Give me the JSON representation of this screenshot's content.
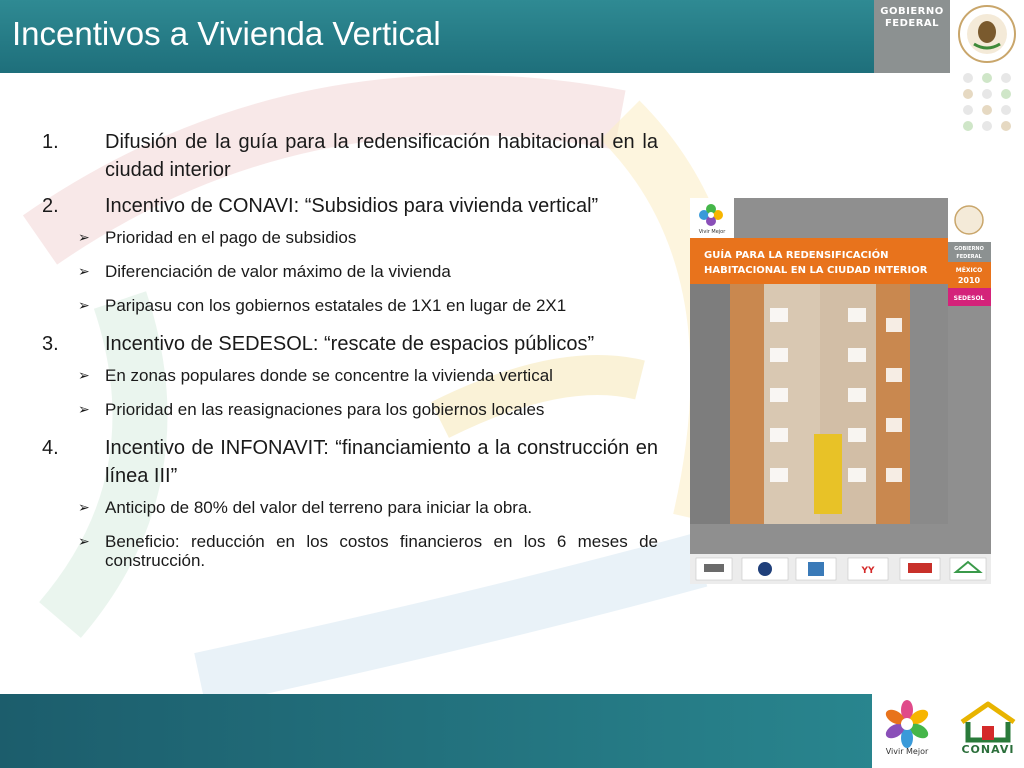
{
  "header": {
    "title": "Incentivos a Vivienda Vertical",
    "gobierno_label": "GOBIERNO FEDERAL"
  },
  "items": [
    {
      "num": "1.",
      "text": "Difusión de la guía para la redensificación habitacional en la ciudad interior",
      "subs": []
    },
    {
      "num": "2.",
      "text": "Incentivo de CONAVI: “Subsidios para vivienda vertical”",
      "subs": [
        "Prioridad en el pago de subsidios",
        "Diferenciación de valor máximo de la vivienda",
        "Paripasu con los gobiernos estatales de 1X1 en lugar de 2X1"
      ]
    },
    {
      "num": "3.",
      "text": "Incentivo de SEDESOL: “rescate de espacios públicos”",
      "subs": [
        "En zonas populares donde se concentre la vivienda vertical",
        "Prioridad en las reasignaciones para los gobiernos locales"
      ]
    },
    {
      "num": "4.",
      "text": " Incentivo de INFONAVIT: “financiamiento a la construcción en línea III”",
      "subs": [
        "Anticipo de 80% del valor del terreno para iniciar la obra.",
        "Beneficio: reducción en los costos financieros en los 6 meses de construcción."
      ]
    }
  ],
  "cover": {
    "title_line1": "GUÍA PARA LA REDENSIFICACIÓN",
    "title_line2": "HABITACIONAL EN LA CIUDAD INTERIOR",
    "vivir_mejor_small": "Vivir Mejor",
    "gob_line1": "GOBIERNO",
    "gob_line2": "FEDERAL",
    "mexico": "MÉXICO",
    "year": "2010",
    "sedesol": "SEDESOL"
  },
  "footer": {
    "vivir_mejor": "Vivir Mejor",
    "conavi": "CONAVI"
  },
  "colors": {
    "header_teal": "#1e6f7b",
    "cover_orange": "#e8731c",
    "cover_pink": "#d4237a"
  }
}
